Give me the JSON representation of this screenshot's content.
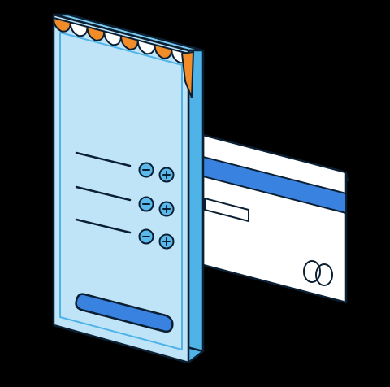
{
  "scene": {
    "background": "#000000",
    "outline": "#0b1f33",
    "phone": {
      "face_color": "#bfe3f7",
      "side_color": "#4fb3e8",
      "top_color": "#7ccaf0",
      "awning_colors": [
        "#f28c28",
        "#ffffff"
      ],
      "awning_side_color": "#f28c28",
      "rows": [
        {
          "minus_icon": "minus-icon",
          "plus_icon": "plus-icon"
        },
        {
          "minus_icon": "minus-icon",
          "plus_icon": "plus-icon"
        },
        {
          "minus_icon": "minus-icon",
          "plus_icon": "plus-icon"
        }
      ],
      "button_color": "#3a82df",
      "control_color": "#5ab8ea"
    },
    "card": {
      "face_color": "#ffffff",
      "stripe_color": "#3a82df",
      "logo_icon": "card-network-logo-icon"
    }
  }
}
